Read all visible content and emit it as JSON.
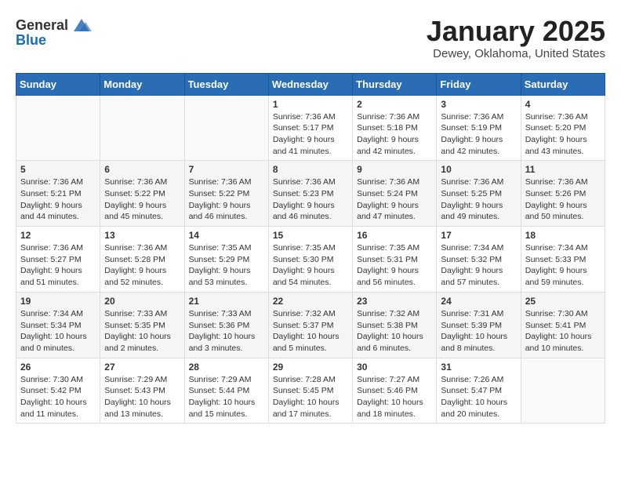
{
  "header": {
    "logo": {
      "general": "General",
      "blue": "Blue"
    },
    "title": "January 2025",
    "location": "Dewey, Oklahoma, United States"
  },
  "weekdays": [
    "Sunday",
    "Monday",
    "Tuesday",
    "Wednesday",
    "Thursday",
    "Friday",
    "Saturday"
  ],
  "weeks": [
    [
      {
        "day": "",
        "sunrise": "",
        "sunset": "",
        "daylight": ""
      },
      {
        "day": "",
        "sunrise": "",
        "sunset": "",
        "daylight": ""
      },
      {
        "day": "",
        "sunrise": "",
        "sunset": "",
        "daylight": ""
      },
      {
        "day": "1",
        "sunrise": "Sunrise: 7:36 AM",
        "sunset": "Sunset: 5:17 PM",
        "daylight": "Daylight: 9 hours and 41 minutes."
      },
      {
        "day": "2",
        "sunrise": "Sunrise: 7:36 AM",
        "sunset": "Sunset: 5:18 PM",
        "daylight": "Daylight: 9 hours and 42 minutes."
      },
      {
        "day": "3",
        "sunrise": "Sunrise: 7:36 AM",
        "sunset": "Sunset: 5:19 PM",
        "daylight": "Daylight: 9 hours and 42 minutes."
      },
      {
        "day": "4",
        "sunrise": "Sunrise: 7:36 AM",
        "sunset": "Sunset: 5:20 PM",
        "daylight": "Daylight: 9 hours and 43 minutes."
      }
    ],
    [
      {
        "day": "5",
        "sunrise": "Sunrise: 7:36 AM",
        "sunset": "Sunset: 5:21 PM",
        "daylight": "Daylight: 9 hours and 44 minutes."
      },
      {
        "day": "6",
        "sunrise": "Sunrise: 7:36 AM",
        "sunset": "Sunset: 5:22 PM",
        "daylight": "Daylight: 9 hours and 45 minutes."
      },
      {
        "day": "7",
        "sunrise": "Sunrise: 7:36 AM",
        "sunset": "Sunset: 5:22 PM",
        "daylight": "Daylight: 9 hours and 46 minutes."
      },
      {
        "day": "8",
        "sunrise": "Sunrise: 7:36 AM",
        "sunset": "Sunset: 5:23 PM",
        "daylight": "Daylight: 9 hours and 46 minutes."
      },
      {
        "day": "9",
        "sunrise": "Sunrise: 7:36 AM",
        "sunset": "Sunset: 5:24 PM",
        "daylight": "Daylight: 9 hours and 47 minutes."
      },
      {
        "day": "10",
        "sunrise": "Sunrise: 7:36 AM",
        "sunset": "Sunset: 5:25 PM",
        "daylight": "Daylight: 9 hours and 49 minutes."
      },
      {
        "day": "11",
        "sunrise": "Sunrise: 7:36 AM",
        "sunset": "Sunset: 5:26 PM",
        "daylight": "Daylight: 9 hours and 50 minutes."
      }
    ],
    [
      {
        "day": "12",
        "sunrise": "Sunrise: 7:36 AM",
        "sunset": "Sunset: 5:27 PM",
        "daylight": "Daylight: 9 hours and 51 minutes."
      },
      {
        "day": "13",
        "sunrise": "Sunrise: 7:36 AM",
        "sunset": "Sunset: 5:28 PM",
        "daylight": "Daylight: 9 hours and 52 minutes."
      },
      {
        "day": "14",
        "sunrise": "Sunrise: 7:35 AM",
        "sunset": "Sunset: 5:29 PM",
        "daylight": "Daylight: 9 hours and 53 minutes."
      },
      {
        "day": "15",
        "sunrise": "Sunrise: 7:35 AM",
        "sunset": "Sunset: 5:30 PM",
        "daylight": "Daylight: 9 hours and 54 minutes."
      },
      {
        "day": "16",
        "sunrise": "Sunrise: 7:35 AM",
        "sunset": "Sunset: 5:31 PM",
        "daylight": "Daylight: 9 hours and 56 minutes."
      },
      {
        "day": "17",
        "sunrise": "Sunrise: 7:34 AM",
        "sunset": "Sunset: 5:32 PM",
        "daylight": "Daylight: 9 hours and 57 minutes."
      },
      {
        "day": "18",
        "sunrise": "Sunrise: 7:34 AM",
        "sunset": "Sunset: 5:33 PM",
        "daylight": "Daylight: 9 hours and 59 minutes."
      }
    ],
    [
      {
        "day": "19",
        "sunrise": "Sunrise: 7:34 AM",
        "sunset": "Sunset: 5:34 PM",
        "daylight": "Daylight: 10 hours and 0 minutes."
      },
      {
        "day": "20",
        "sunrise": "Sunrise: 7:33 AM",
        "sunset": "Sunset: 5:35 PM",
        "daylight": "Daylight: 10 hours and 2 minutes."
      },
      {
        "day": "21",
        "sunrise": "Sunrise: 7:33 AM",
        "sunset": "Sunset: 5:36 PM",
        "daylight": "Daylight: 10 hours and 3 minutes."
      },
      {
        "day": "22",
        "sunrise": "Sunrise: 7:32 AM",
        "sunset": "Sunset: 5:37 PM",
        "daylight": "Daylight: 10 hours and 5 minutes."
      },
      {
        "day": "23",
        "sunrise": "Sunrise: 7:32 AM",
        "sunset": "Sunset: 5:38 PM",
        "daylight": "Daylight: 10 hours and 6 minutes."
      },
      {
        "day": "24",
        "sunrise": "Sunrise: 7:31 AM",
        "sunset": "Sunset: 5:39 PM",
        "daylight": "Daylight: 10 hours and 8 minutes."
      },
      {
        "day": "25",
        "sunrise": "Sunrise: 7:30 AM",
        "sunset": "Sunset: 5:41 PM",
        "daylight": "Daylight: 10 hours and 10 minutes."
      }
    ],
    [
      {
        "day": "26",
        "sunrise": "Sunrise: 7:30 AM",
        "sunset": "Sunset: 5:42 PM",
        "daylight": "Daylight: 10 hours and 11 minutes."
      },
      {
        "day": "27",
        "sunrise": "Sunrise: 7:29 AM",
        "sunset": "Sunset: 5:43 PM",
        "daylight": "Daylight: 10 hours and 13 minutes."
      },
      {
        "day": "28",
        "sunrise": "Sunrise: 7:29 AM",
        "sunset": "Sunset: 5:44 PM",
        "daylight": "Daylight: 10 hours and 15 minutes."
      },
      {
        "day": "29",
        "sunrise": "Sunrise: 7:28 AM",
        "sunset": "Sunset: 5:45 PM",
        "daylight": "Daylight: 10 hours and 17 minutes."
      },
      {
        "day": "30",
        "sunrise": "Sunrise: 7:27 AM",
        "sunset": "Sunset: 5:46 PM",
        "daylight": "Daylight: 10 hours and 18 minutes."
      },
      {
        "day": "31",
        "sunrise": "Sunrise: 7:26 AM",
        "sunset": "Sunset: 5:47 PM",
        "daylight": "Daylight: 10 hours and 20 minutes."
      },
      {
        "day": "",
        "sunrise": "",
        "sunset": "",
        "daylight": ""
      }
    ]
  ]
}
